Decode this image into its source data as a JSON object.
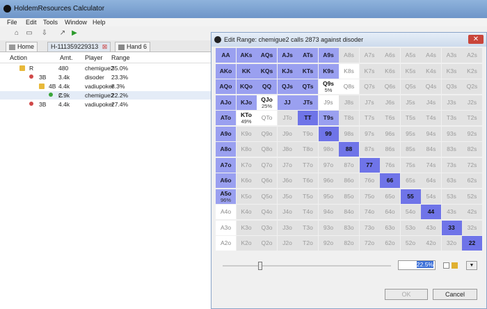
{
  "app": {
    "title": "HoldemResources Calculator"
  },
  "menu": [
    "File",
    "Edit",
    "Tools",
    "Window",
    "Help"
  ],
  "tabs": [
    {
      "label": "Home"
    },
    {
      "label": "H-111359229313"
    },
    {
      "label": "Hand 6"
    }
  ],
  "tree": {
    "headers": [
      "Action",
      "Amt.",
      "Player",
      "Range"
    ],
    "rows": [
      {
        "action": "R",
        "amt": "480",
        "player": "chemigue2",
        "range": "35.0%",
        "marker": "lock",
        "indent": 0,
        "selected": false
      },
      {
        "action": "3B",
        "amt": "3.4k",
        "player": "disoder",
        "range": "23.3%",
        "marker": "red",
        "indent": 1,
        "selected": false
      },
      {
        "action": "4B",
        "amt": "4.4k",
        "player": "vadiupoker",
        "range": "8.3%",
        "marker": "lock",
        "indent": 2,
        "selected": false
      },
      {
        "action": "C",
        "amt": "2.9k",
        "player": "chemigue2",
        "range": "22.2%",
        "marker": "green",
        "indent": 3,
        "selected": true
      },
      {
        "action": "3B",
        "amt": "4.4k",
        "player": "vadiupoker",
        "range": "27.4%",
        "marker": "red",
        "indent": 1,
        "selected": false
      }
    ]
  },
  "dialog": {
    "title": "Edit Range: chemigue2 calls 2873 against disoder",
    "percent_value": "22.5%",
    "ok_label": "OK",
    "cancel_label": "Cancel",
    "slider_fraction": 0.225
  },
  "grid": {
    "rows": [
      [
        "AA",
        "AKs",
        "AQs",
        "AJs",
        "ATs",
        "A9s",
        "A8s",
        "A7s",
        "A6s",
        "A5s",
        "A4s",
        "A3s",
        "A2s"
      ],
      [
        "AKo",
        "KK",
        "KQs",
        "KJs",
        "KTs",
        "K9s",
        "K8s",
        "K7s",
        "K6s",
        "K5s",
        "K4s",
        "K3s",
        "K2s"
      ],
      [
        "AQo",
        "KQo",
        "QQ",
        "QJs",
        "QTs",
        "Q9s",
        "Q8s",
        "Q7s",
        "Q6s",
        "Q5s",
        "Q4s",
        "Q3s",
        "Q2s"
      ],
      [
        "AJo",
        "KJo",
        "QJo",
        "JJ",
        "JTs",
        "J9s",
        "J8s",
        "J7s",
        "J6s",
        "J5s",
        "J4s",
        "J3s",
        "J2s"
      ],
      [
        "ATo",
        "KTo",
        "QTo",
        "JTo",
        "TT",
        "T9s",
        "T8s",
        "T7s",
        "T6s",
        "T5s",
        "T4s",
        "T3s",
        "T2s"
      ],
      [
        "A9o",
        "K9o",
        "Q9o",
        "J9o",
        "T9o",
        "99",
        "98s",
        "97s",
        "96s",
        "95s",
        "94s",
        "93s",
        "92s"
      ],
      [
        "A8o",
        "K8o",
        "Q8o",
        "J8o",
        "T8o",
        "98o",
        "88",
        "87s",
        "86s",
        "85s",
        "84s",
        "83s",
        "82s"
      ],
      [
        "A7o",
        "K7o",
        "Q7o",
        "J7o",
        "T7o",
        "97o",
        "87o",
        "77",
        "76s",
        "75s",
        "74s",
        "73s",
        "72s"
      ],
      [
        "A6o",
        "K6o",
        "Q6o",
        "J6o",
        "T6o",
        "96o",
        "86o",
        "76o",
        "66",
        "65s",
        "64s",
        "63s",
        "62s"
      ],
      [
        "A5o",
        "K5o",
        "Q5o",
        "J5o",
        "T5o",
        "95o",
        "85o",
        "75o",
        "65o",
        "55",
        "54s",
        "53s",
        "52s"
      ],
      [
        "A4o",
        "K4o",
        "Q4o",
        "J4o",
        "T4o",
        "94o",
        "84o",
        "74o",
        "64o",
        "54o",
        "44",
        "43s",
        "42s"
      ],
      [
        "A3o",
        "K3o",
        "Q3o",
        "J3o",
        "T3o",
        "93o",
        "83o",
        "73o",
        "63o",
        "53o",
        "43o",
        "33",
        "32s"
      ],
      [
        "A2o",
        "K2o",
        "Q2o",
        "J2o",
        "T2o",
        "92o",
        "82o",
        "72o",
        "62o",
        "52o",
        "42o",
        "32o",
        "22"
      ]
    ],
    "full": [
      "AA",
      "AKs",
      "AQs",
      "AJs",
      "ATs",
      "A9s",
      "AKo",
      "KK",
      "KQs",
      "KJs",
      "KTs",
      "K9s",
      "AQo",
      "KQo",
      "QQ",
      "QJs",
      "QTs",
      "AJo",
      "KJo",
      "JJ",
      "JTs",
      "T9s",
      "ATo",
      "TT",
      "A9o",
      "99",
      "A8o",
      "88",
      "A7o",
      "77",
      "A6o",
      "66",
      "A5o",
      "55",
      "44",
      "33",
      "22"
    ],
    "partial": {
      "Q9s": "5%",
      "QJo": "25%",
      "KTo": "49%",
      "A5o": "96%"
    },
    "white": [
      "K8s",
      "Q8s",
      "J9s",
      "QTo",
      "A4o",
      "A3o",
      "A2o"
    ]
  },
  "colors": {
    "full": "#9aa0f0",
    "pair": "#6f74e8",
    "empty": "#e2e2e2"
  }
}
